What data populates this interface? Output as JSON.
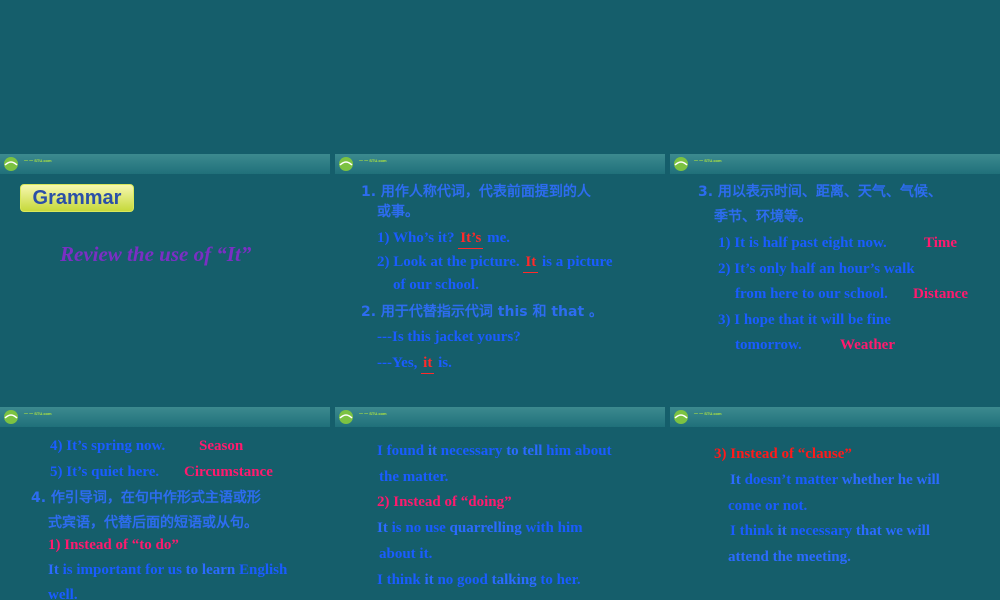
{
  "colors": {
    "background": "#155e6b",
    "header_bar": "#2a7b84",
    "blue_text": "#1a5cff",
    "pink_text": "#ff1a6e",
    "purple_text": "#7b2fc4"
  },
  "logo": {
    "text": "一 一 STU.com"
  },
  "slide1": {
    "badge": "Grammar",
    "subtitle": "Review the use of “It”"
  },
  "slide2": {
    "heading1_a": "1.  用作人称代词，代表前面提到的人",
    "heading1_b": "或事。",
    "q1_prefix": "1) Who’s it?",
    "q1_blank": "It’s",
    "q1_suffix": "me.",
    "q2_prefix": "2) Look at the picture.",
    "q2_blank": "It",
    "q2_suffix": "is a picture",
    "q2_cont": "of our school.",
    "heading2": "2.  用于代替指示代词 this 和 that 。",
    "q3": "---Is this jacket yours?",
    "q4_prefix": "---Yes,",
    "q4_blank": "it",
    "q4_suffix": "is."
  },
  "slide3": {
    "heading_a": "3.  用以表示时间、距离、天气、气候、",
    "heading_b": "季节、环境等。",
    "s1": "1) It is half past eight now.",
    "s1_tag": "Time",
    "s2_a": "2) It’s only half an hour’s walk",
    "s2_b": "from here to our school.",
    "s2_tag": "Distance",
    "s3_a": "3) I hope that it will be fine",
    "s3_b": "tomorrow.",
    "s3_tag": "Weather"
  },
  "slide4": {
    "s4": "4) It’s spring now.",
    "s4_tag": "Season",
    "s5": "5) It’s quiet here.",
    "s5_tag": "Circumstance",
    "heading_a": "4.  作引导词，在句中作形式主语或形",
    "heading_b": "式宾语，代替后面的短语或从句。",
    "sub": "1) Instead of “to do”",
    "ex_w1": "It",
    "ex_w2": "is important for us",
    "ex_w3": "to learn",
    "ex_w4": "English",
    "ex_w5": "well."
  },
  "slide5": {
    "l1_w1": "I found",
    "l1_w2": "it",
    "l1_w3": "necessary",
    "l1_w4": "to tell",
    "l1_w5": "him about",
    "l2": "the matter.",
    "sub": "2) Instead of “doing”",
    "l3_w1": "It",
    "l3_w2": "is no use",
    "l3_w3": "quarrelling",
    "l3_w4": "with him",
    "l4": "about it.",
    "l5_w1": "I think",
    "l5_w2": "it",
    "l5_w3": "no good",
    "l5_w4": "talking",
    "l5_w5": "to her."
  },
  "slide6": {
    "sub": "3) Instead of “clause”",
    "l1_w1": "It",
    "l1_w2": "doesn’t matter",
    "l1_w3": "whether he will",
    "l2": "come or not.",
    "l3_w1": "I think",
    "l3_w2": "it",
    "l3_w3": "necessary",
    "l3_w4": "that we will",
    "l4": "attend the meeting."
  }
}
